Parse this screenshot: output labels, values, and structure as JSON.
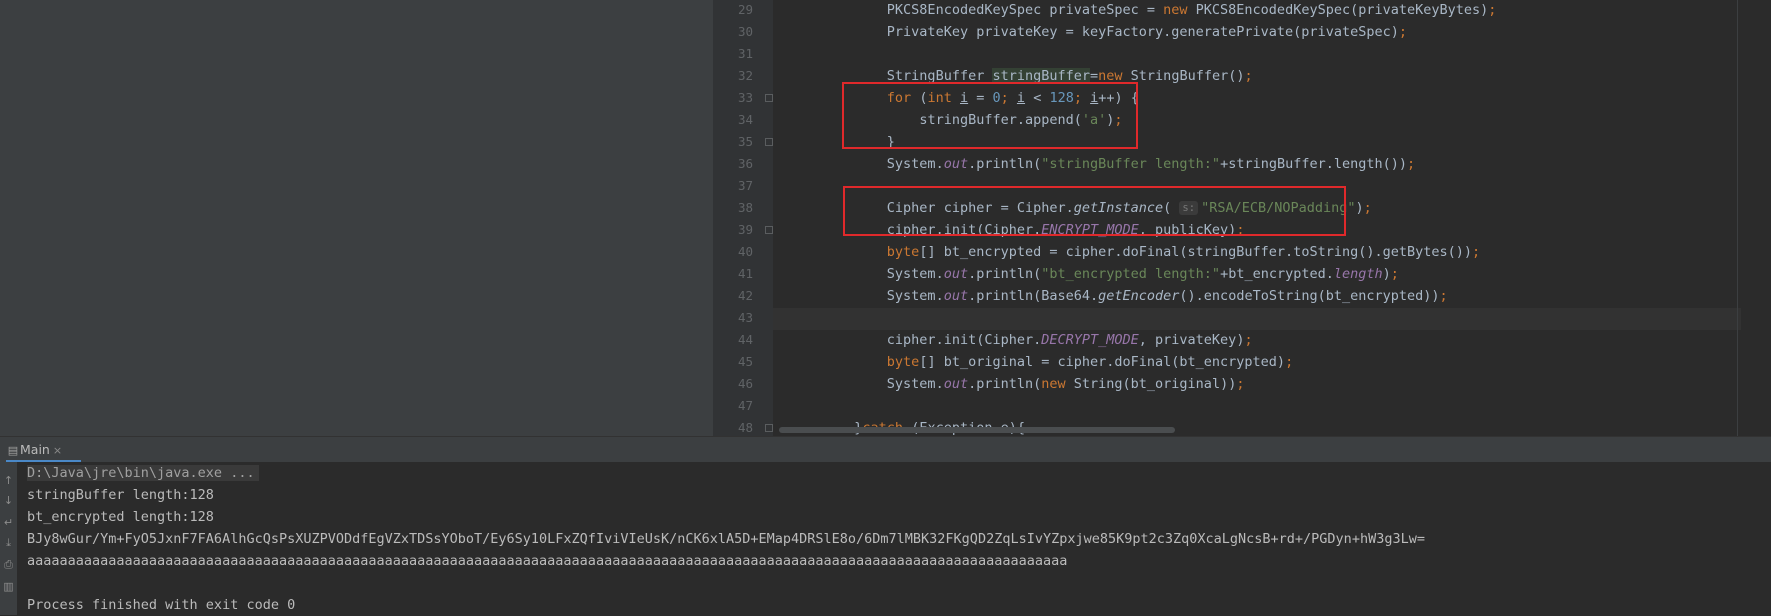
{
  "editor": {
    "line_numbers": [
      "29",
      "30",
      "31",
      "32",
      "33",
      "34",
      "35",
      "36",
      "37",
      "38",
      "39",
      "40",
      "41",
      "42",
      "43",
      "44",
      "45",
      "46",
      "47",
      "48"
    ],
    "lines": [
      {
        "num": "29",
        "indent": "        ",
        "parts": [
          [
            "PKCS8EncodedKeySpec privateSpec = ",
            ""
          ],
          [
            "new",
            "kw"
          ],
          [
            " PKCS8EncodedKeySpec(privateKeyBytes)",
            ""
          ],
          [
            ";",
            "kw"
          ]
        ]
      },
      {
        "num": "30",
        "indent": "        ",
        "parts": [
          [
            "PrivateKey privateKey = keyFactory.generatePrivate(privateSpec)",
            ""
          ],
          [
            ";",
            "kw"
          ]
        ]
      },
      {
        "num": "31",
        "indent": "",
        "parts": []
      },
      {
        "num": "32",
        "indent": "        ",
        "parts": [
          [
            "StringBuffer ",
            ""
          ],
          [
            "stringBuffer",
            "hl"
          ],
          [
            "=",
            ""
          ],
          [
            "new",
            "kw"
          ],
          [
            " StringBuffer()",
            ""
          ],
          [
            ";",
            "kw"
          ]
        ]
      },
      {
        "num": "33",
        "indent": "        ",
        "parts": [
          [
            "for",
            "kw"
          ],
          [
            " (",
            ""
          ],
          [
            "int",
            "kw"
          ],
          [
            " ",
            ""
          ],
          [
            "i",
            "var-ul"
          ],
          [
            " = ",
            ""
          ],
          [
            "0",
            "num"
          ],
          [
            "; ",
            "kw"
          ],
          [
            "i",
            "var-ul"
          ],
          [
            " < ",
            ""
          ],
          [
            "128",
            "num"
          ],
          [
            "; ",
            "kw"
          ],
          [
            "i",
            "var-ul"
          ],
          [
            "++) {",
            ""
          ]
        ]
      },
      {
        "num": "34",
        "indent": "            ",
        "parts": [
          [
            "stringBuffer.append(",
            ""
          ],
          [
            "'a'",
            "str"
          ],
          [
            ")",
            ""
          ],
          [
            ";",
            "kw"
          ]
        ]
      },
      {
        "num": "35",
        "indent": "        ",
        "parts": [
          [
            "}",
            ""
          ]
        ]
      },
      {
        "num": "36",
        "indent": "        ",
        "parts": [
          [
            "System.",
            ""
          ],
          [
            "out",
            "field"
          ],
          [
            ".println(",
            ""
          ],
          [
            "\"stringBuffer length:\"",
            "str"
          ],
          [
            "+stringBuffer.length())",
            ""
          ],
          [
            ";",
            "kw"
          ]
        ]
      },
      {
        "num": "37",
        "indent": "",
        "parts": []
      },
      {
        "num": "38",
        "indent": "        ",
        "parts": [
          [
            "Cipher cipher = Cipher.",
            ""
          ],
          [
            "getInstance",
            "ital"
          ],
          [
            "( ",
            ""
          ],
          [
            "s:",
            "hint"
          ],
          [
            "\"RSA/ECB/NOPadding\"",
            "str"
          ],
          [
            ")",
            ""
          ],
          [
            ";",
            "kw"
          ]
        ]
      },
      {
        "num": "39",
        "indent": "        ",
        "parts": [
          [
            "cipher.init(Cipher.",
            ""
          ],
          [
            "ENCRYPT_MODE",
            "field"
          ],
          [
            ", publicKey)",
            ""
          ],
          [
            ";",
            "kw"
          ]
        ]
      },
      {
        "num": "40",
        "indent": "        ",
        "parts": [
          [
            "byte",
            "kw"
          ],
          [
            "[] bt_encrypted = cipher.doFinal(stringBuffer.toString().getBytes())",
            ""
          ],
          [
            ";",
            "kw"
          ]
        ]
      },
      {
        "num": "41",
        "indent": "        ",
        "parts": [
          [
            "System.",
            ""
          ],
          [
            "out",
            "field"
          ],
          [
            ".println(",
            ""
          ],
          [
            "\"bt_encrypted length:\"",
            "str"
          ],
          [
            "+bt_encrypted.",
            ""
          ],
          [
            "length",
            "field"
          ],
          [
            ")",
            ""
          ],
          [
            ";",
            "kw"
          ]
        ]
      },
      {
        "num": "42",
        "indent": "        ",
        "parts": [
          [
            "System.",
            ""
          ],
          [
            "out",
            "field"
          ],
          [
            ".println(Base64.",
            ""
          ],
          [
            "getEncoder",
            "ital"
          ],
          [
            "().encodeToString(bt_encrypted))",
            ""
          ],
          [
            ";",
            "kw"
          ]
        ]
      },
      {
        "num": "43",
        "indent": "",
        "parts": []
      },
      {
        "num": "44",
        "indent": "        ",
        "parts": [
          [
            "cipher.init(Cipher.",
            ""
          ],
          [
            "DECRYPT_MODE",
            "field"
          ],
          [
            ", privateKey)",
            ""
          ],
          [
            ";",
            "kw"
          ]
        ]
      },
      {
        "num": "45",
        "indent": "        ",
        "parts": [
          [
            "byte",
            "kw"
          ],
          [
            "[] bt_original = cipher.doFinal(bt_encrypted)",
            ""
          ],
          [
            ";",
            "kw"
          ]
        ]
      },
      {
        "num": "46",
        "indent": "        ",
        "parts": [
          [
            "System.",
            ""
          ],
          [
            "out",
            "field"
          ],
          [
            ".println(",
            ""
          ],
          [
            "new",
            "kw"
          ],
          [
            " String(bt_original))",
            ""
          ],
          [
            ";",
            "kw"
          ]
        ]
      },
      {
        "num": "47",
        "indent": "",
        "parts": []
      },
      {
        "num": "48",
        "indent": "    ",
        "parts": [
          [
            "}",
            ""
          ],
          [
            "catch",
            "kw"
          ],
          [
            " (Exception e){",
            ""
          ]
        ]
      }
    ]
  },
  "run_panel": {
    "tab_label": "Main",
    "close_symbol": "×"
  },
  "console": {
    "command": "D:\\Java\\jre\\bin\\java.exe ...",
    "output": [
      "stringBuffer length:128",
      "bt_encrypted length:128",
      "BJy8wGur/Ym+FyO5JxnF7FA6AlhGcQsPsXUZPVODdfEgVZxTDSsYOboT/Ey6Sy10LFxZQfIviVIeUsK/nCK6xlA5D+EMap4DRSlE8o/6Dm7lMBK32FKgQD2ZqLsIvYZpxjwe85K9pt2c3Zq0XcaLgNcsB+rd+/PGDyn+hW3g3Lw=",
      "aaaaaaaaaaaaaaaaaaaaaaaaaaaaaaaaaaaaaaaaaaaaaaaaaaaaaaaaaaaaaaaaaaaaaaaaaaaaaaaaaaaaaaaaaaaaaaaaaaaaaaaaaaaaaaaaaaaaaaaaaaaaaaaa",
      "",
      "Process finished with exit code 0"
    ]
  }
}
